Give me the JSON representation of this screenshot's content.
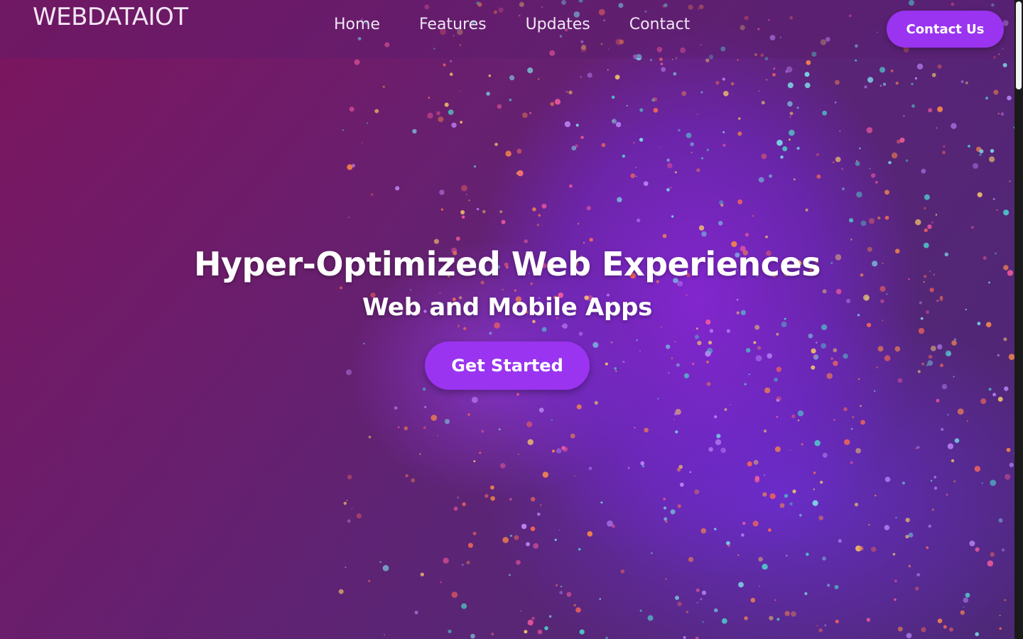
{
  "brand": {
    "logo_text": "WEBDATAIOT"
  },
  "nav": {
    "links": [
      {
        "label": "Home"
      },
      {
        "label": "Features"
      },
      {
        "label": "Updates"
      },
      {
        "label": "Contact"
      }
    ],
    "cta_label": "Contact Us"
  },
  "hero": {
    "title": "Hyper-Optimized Web Experiences",
    "subtitle": "Web and Mobile Apps",
    "cta_label": "Get Started",
    "background_description_icon": "glitter-face-image"
  },
  "colors": {
    "accent": "#9a34f0",
    "text": "#ffffff",
    "background_primary": "#5a1f7e",
    "background_secondary": "#7e1660"
  }
}
